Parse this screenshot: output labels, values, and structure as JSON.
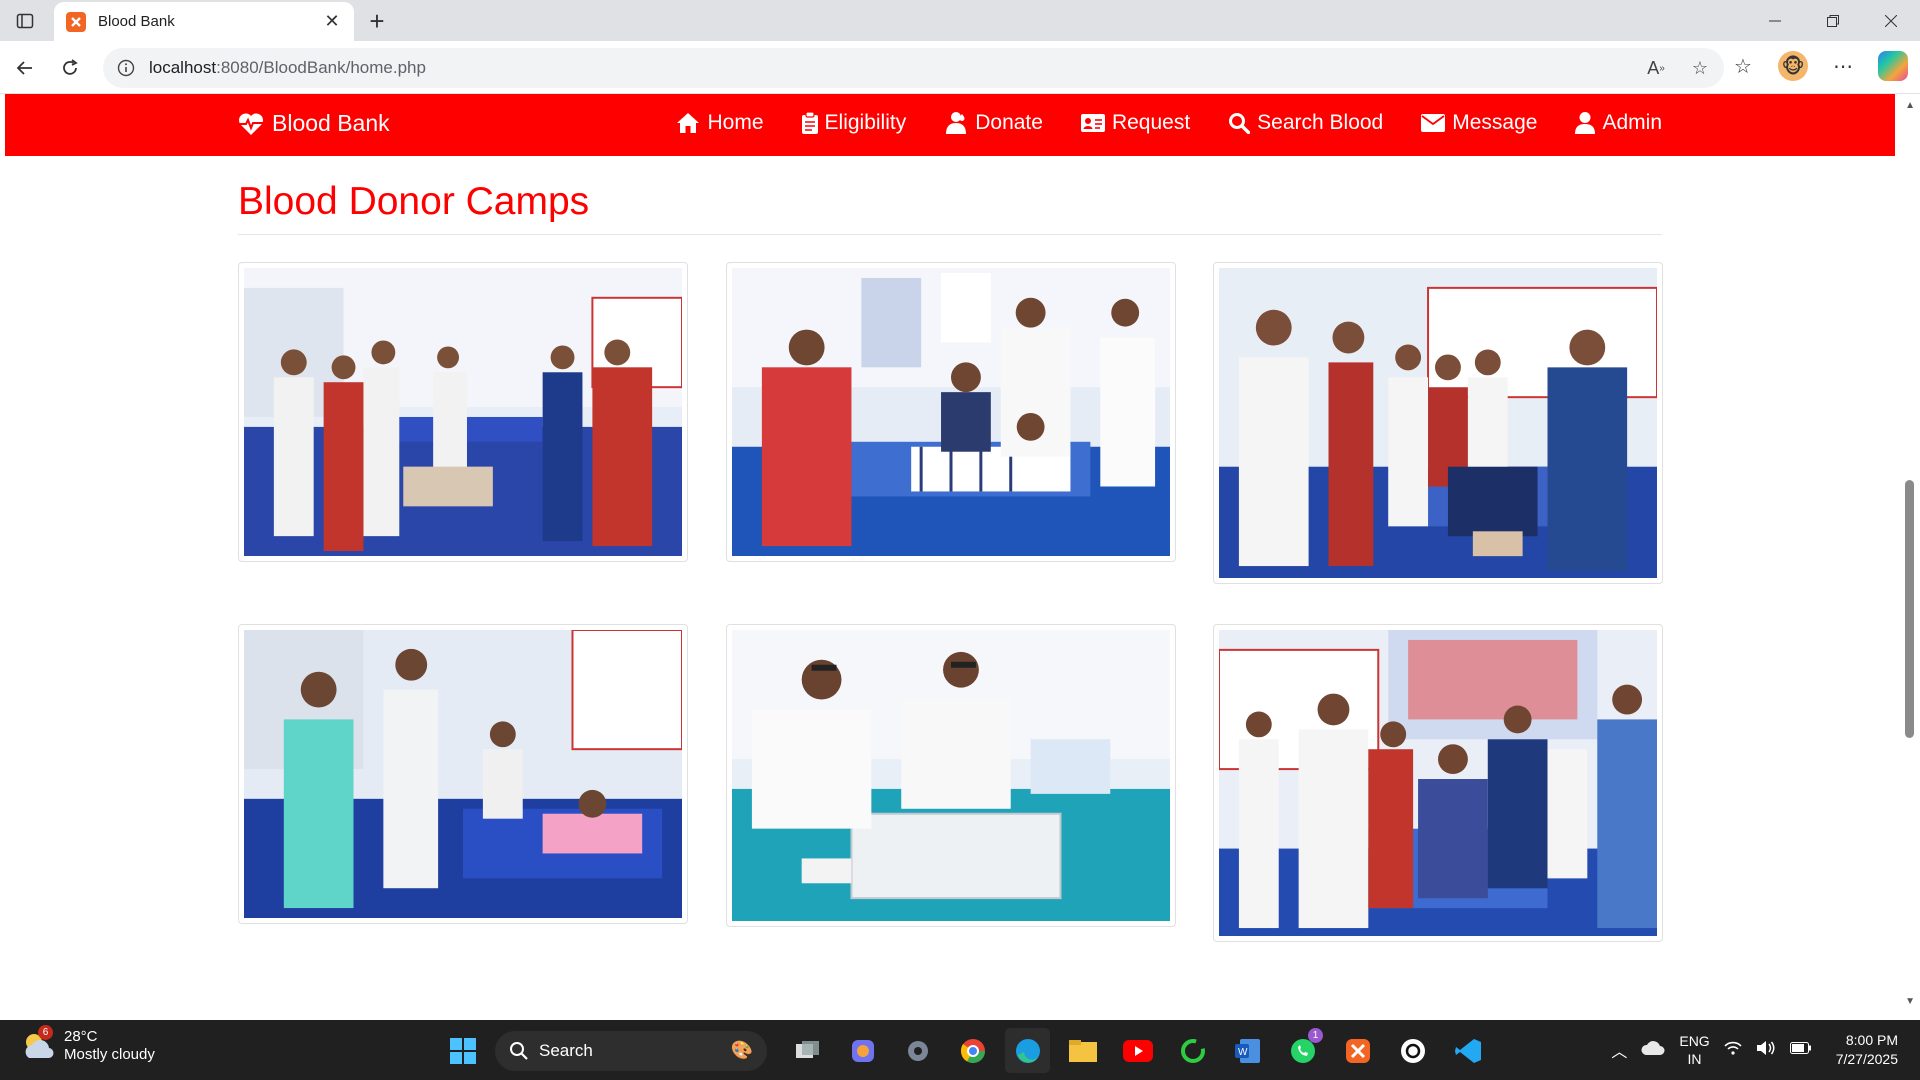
{
  "browser": {
    "tab_title": "Blood Bank",
    "url_host": "localhost",
    "url_rest": ":8080/BloodBank/home.php"
  },
  "site": {
    "brand": "Blood Bank",
    "nav": [
      {
        "label": "Home",
        "icon": "home-icon"
      },
      {
        "label": "Eligibility",
        "icon": "clipboard-icon"
      },
      {
        "label": "Donate",
        "icon": "donor-icon"
      },
      {
        "label": "Request",
        "icon": "id-card-icon"
      },
      {
        "label": "Search Blood",
        "icon": "search-icon"
      },
      {
        "label": "Message",
        "icon": "envelope-icon"
      },
      {
        "label": "Admin",
        "icon": "user-icon"
      }
    ],
    "colors": {
      "primary": "#ff0000"
    }
  },
  "section": {
    "title": "Blood Donor Camps"
  },
  "gallery": {
    "photo_count": 6
  },
  "taskbar": {
    "weather_temp": "28°C",
    "weather_desc": "Mostly cloudy",
    "weather_badge": "6",
    "search_label": "Search",
    "whatsapp_badge": "1",
    "lang_line1": "ENG",
    "lang_line2": "IN",
    "time": "8:00 PM",
    "date": "7/27/2025"
  }
}
